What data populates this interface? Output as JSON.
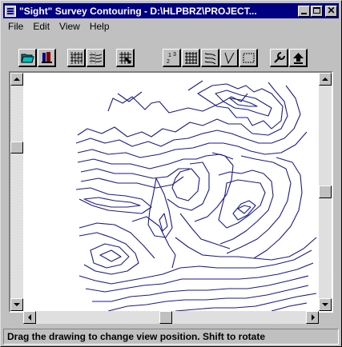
{
  "window": {
    "title": "\"Sight\" Survey Contouring - D:\\HLPBRZ\\PROJECT..."
  },
  "menu": {
    "items": [
      "File",
      "Edit",
      "View",
      "Help"
    ]
  },
  "toolbar": {
    "buttons": [
      {
        "name": "open-folder-icon"
      },
      {
        "name": "save-icon"
      },
      {
        "name": "grid-mesh-icon"
      },
      {
        "name": "contour-icon"
      },
      {
        "name": "grid-edit-icon"
      },
      {
        "name": "numbers-icon",
        "glyph": "1 3\n2"
      },
      {
        "name": "grid-pattern-icon"
      },
      {
        "name": "contour-lines-icon"
      },
      {
        "name": "lines-icon"
      },
      {
        "name": "selection-rect-icon"
      },
      {
        "name": "wrench-icon"
      },
      {
        "name": "upload-icon"
      }
    ]
  },
  "status": {
    "text": "Drag the drawing to change view position. Shift to rotate"
  },
  "colors": {
    "titlebar": "#000080",
    "contour": "#1a1a8c",
    "chrome": "#c0c0c0"
  }
}
